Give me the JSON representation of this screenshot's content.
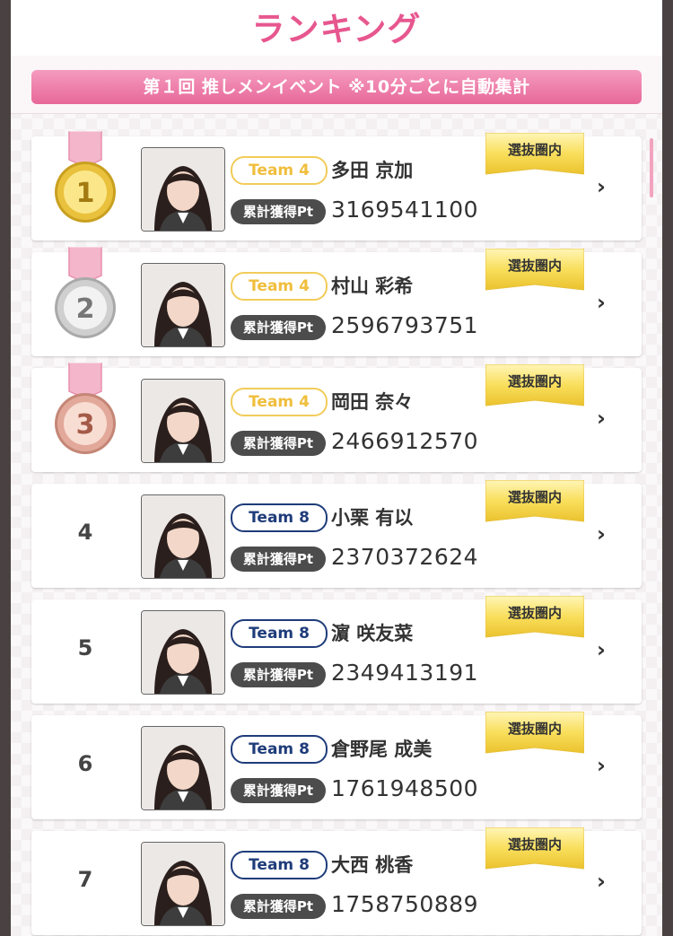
{
  "header": {
    "title": "ランキング"
  },
  "banner": {
    "text": "第１回 推しメンイベント ※10分ごとに自動集計"
  },
  "colors": {
    "accent": "#e7578f",
    "team4": "#f2cc5a",
    "team8": "#1f3c7a"
  },
  "labels": {
    "points": "累計獲得Pt",
    "badge": "選抜圏内"
  },
  "entries": [
    {
      "rank": "1",
      "medal": "gold",
      "team": "Team 4",
      "team_class": "t4",
      "name": "多田 京加",
      "points": "3169541100"
    },
    {
      "rank": "2",
      "medal": "silver",
      "team": "Team 4",
      "team_class": "t4",
      "name": "村山 彩希",
      "points": "2596793751"
    },
    {
      "rank": "3",
      "medal": "bronze",
      "team": "Team 4",
      "team_class": "t4",
      "name": "岡田 奈々",
      "points": "2466912570"
    },
    {
      "rank": "4",
      "medal": "",
      "team": "Team 8",
      "team_class": "t8",
      "name": "小栗 有以",
      "points": "2370372624"
    },
    {
      "rank": "5",
      "medal": "",
      "team": "Team 8",
      "team_class": "t8",
      "name": "濵 咲友菜",
      "points": "2349413191"
    },
    {
      "rank": "6",
      "medal": "",
      "team": "Team 8",
      "team_class": "t8",
      "name": "倉野尾 成美",
      "points": "1761948500"
    },
    {
      "rank": "7",
      "medal": "",
      "team": "Team 8",
      "team_class": "t8",
      "name": "大西 桃香",
      "points": "1758750889"
    }
  ]
}
